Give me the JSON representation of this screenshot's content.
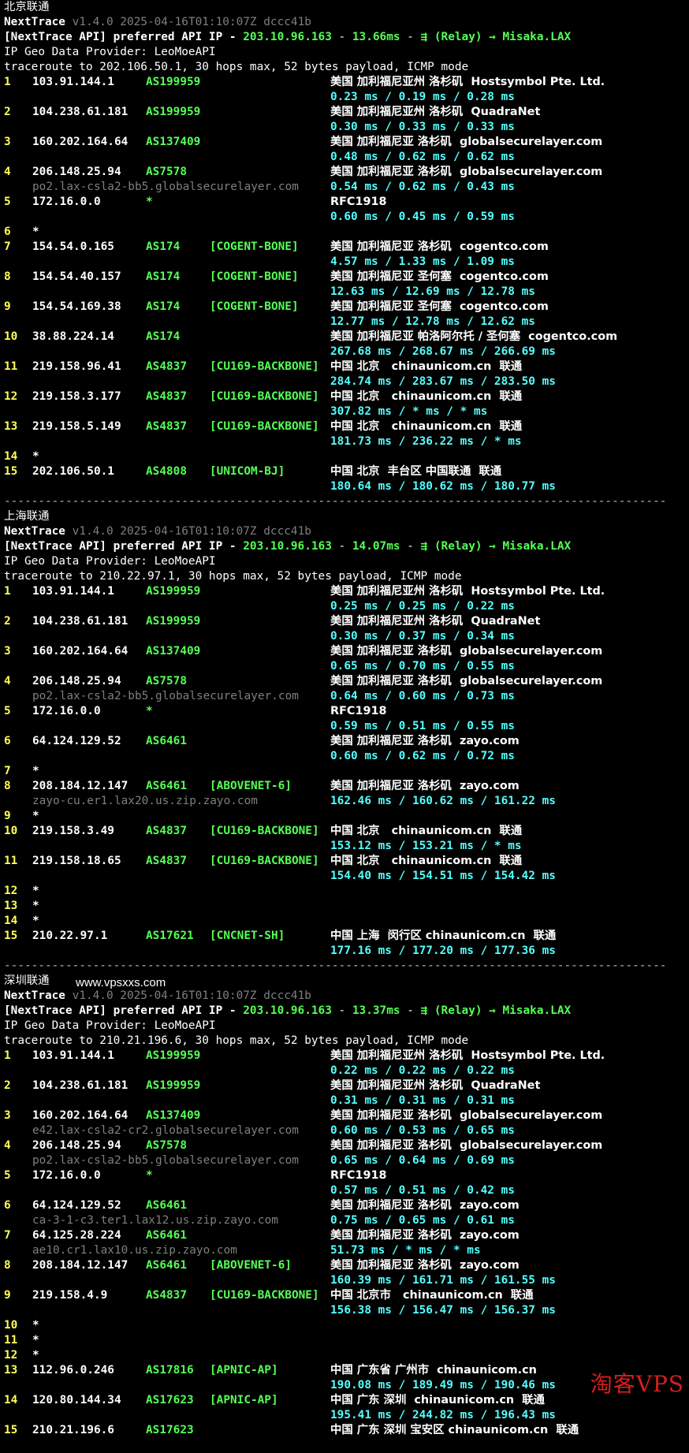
{
  "watermarks": {
    "site": "www.vpsxxs.com",
    "logo": "淘客VPS"
  },
  "separator": "-------------------------------------------------------------------------------------------------",
  "sections": [
    {
      "title": "北京联通",
      "header": {
        "app": "NextTrace",
        "version": "v1.4.0 2025-04-16T01:10:07Z dccc41b",
        "api_prefix": "[NextTrace API] preferred API IP - ",
        "api_ip": "203.10.96.163",
        "api_sep1": " - ",
        "api_latency": "13.66ms",
        "api_sep2": " - ",
        "relay": "⇶ (Relay) → Misaka.LAX",
        "geo_provider": "IP Geo Data Provider: LeoMoeAPI",
        "traceroute": "traceroute to 202.106.50.1, 30 hops max, 52 bytes payload, ICMP mode"
      },
      "hops": [
        {
          "hop": "1",
          "ip": "103.91.144.1",
          "asn": "AS199959",
          "tag": "",
          "geo": "美国 加利福尼亚州 洛杉矶  Hostsymbol Pte. Ltd.",
          "rdns": "",
          "rtt": "0.23 ms / 0.19 ms / 0.28 ms"
        },
        {
          "hop": "2",
          "ip": "104.238.61.181",
          "asn": "AS199959",
          "tag": "",
          "geo": "美国 加利福尼亚州 洛杉矶  QuadraNet",
          "rdns": "",
          "rtt": "0.30 ms / 0.33 ms / 0.33 ms"
        },
        {
          "hop": "3",
          "ip": "160.202.164.64",
          "asn": "AS137409",
          "tag": "",
          "geo": "美国 加利福尼亚 洛杉矶  globalsecurelayer.com",
          "rdns": "",
          "rtt": "0.48 ms / 0.62 ms / 0.62 ms"
        },
        {
          "hop": "4",
          "ip": "206.148.25.94",
          "asn": "AS7578",
          "tag": "",
          "geo": "美国 加利福尼亚 洛杉矶  globalsecurelayer.com",
          "rdns": "po2.lax-csla2-bb5.globalsecurelayer.com",
          "rtt": "0.54 ms / 0.62 ms / 0.43 ms"
        },
        {
          "hop": "5",
          "ip": "172.16.0.0",
          "asn": "*",
          "tag": "",
          "geo": "RFC1918",
          "rdns": "",
          "rtt": "0.60 ms / 0.45 ms / 0.59 ms"
        },
        {
          "hop": "6",
          "star": "*"
        },
        {
          "hop": "7",
          "ip": "154.54.0.165",
          "asn": "AS174",
          "tag": "[COGENT-BONE]",
          "geo": "美国 加利福尼亚 洛杉矶  cogentco.com",
          "rdns": "",
          "rtt": "4.57 ms / 1.33 ms / 1.09 ms"
        },
        {
          "hop": "8",
          "ip": "154.54.40.157",
          "asn": "AS174",
          "tag": "[COGENT-BONE]",
          "geo": "美国 加利福尼亚 圣何塞  cogentco.com",
          "rdns": "",
          "rtt": "12.63 ms / 12.69 ms / 12.78 ms"
        },
        {
          "hop": "9",
          "ip": "154.54.169.38",
          "asn": "AS174",
          "tag": "[COGENT-BONE]",
          "geo": "美国 加利福尼亚 圣何塞  cogentco.com",
          "rdns": "",
          "rtt": "12.77 ms / 12.78 ms / 12.62 ms"
        },
        {
          "hop": "10",
          "ip": "38.88.224.14",
          "asn": "AS174",
          "tag": "",
          "geo": "美国 加利福尼亚 帕洛阿尔托 / 圣何塞  cogentco.com",
          "rdns": "",
          "rtt": "267.68 ms / 268.67 ms / 266.69 ms"
        },
        {
          "hop": "11",
          "ip": "219.158.96.41",
          "asn": "AS4837",
          "tag": "[CU169-BACKBONE]",
          "geo": "中国 北京   chinaunicom.cn  联通",
          "rdns": "",
          "rtt": "284.74 ms / 283.67 ms / 283.50 ms"
        },
        {
          "hop": "12",
          "ip": "219.158.3.177",
          "asn": "AS4837",
          "tag": "[CU169-BACKBONE]",
          "geo": "中国 北京   chinaunicom.cn  联通",
          "rdns": "",
          "rtt": "307.82 ms / * ms / * ms"
        },
        {
          "hop": "13",
          "ip": "219.158.5.149",
          "asn": "AS4837",
          "tag": "[CU169-BACKBONE]",
          "geo": "中国 北京   chinaunicom.cn  联通",
          "rdns": "",
          "rtt": "181.73 ms / 236.22 ms / * ms"
        },
        {
          "hop": "14",
          "star": "*"
        },
        {
          "hop": "15",
          "ip": "202.106.50.1",
          "asn": "AS4808",
          "tag": "[UNICOM-BJ]",
          "geo": "中国 北京  丰台区 中国联通  联通",
          "rdns": "",
          "rtt": "180.64 ms / 180.62 ms / 180.77 ms"
        }
      ]
    },
    {
      "title": "上海联通",
      "header": {
        "app": "NextTrace",
        "version": "v1.4.0 2025-04-16T01:10:07Z dccc41b",
        "api_prefix": "[NextTrace API] preferred API IP - ",
        "api_ip": "203.10.96.163",
        "api_sep1": " - ",
        "api_latency": "14.07ms",
        "api_sep2": " - ",
        "relay": "⇶ (Relay) → Misaka.LAX",
        "geo_provider": "IP Geo Data Provider: LeoMoeAPI",
        "traceroute": "traceroute to 210.22.97.1, 30 hops max, 52 bytes payload, ICMP mode"
      },
      "hops": [
        {
          "hop": "1",
          "ip": "103.91.144.1",
          "asn": "AS199959",
          "tag": "",
          "geo": "美国 加利福尼亚州 洛杉矶  Hostsymbol Pte. Ltd.",
          "rdns": "",
          "rtt": "0.25 ms / 0.25 ms / 0.22 ms"
        },
        {
          "hop": "2",
          "ip": "104.238.61.181",
          "asn": "AS199959",
          "tag": "",
          "geo": "美国 加利福尼亚州 洛杉矶  QuadraNet",
          "rdns": "",
          "rtt": "0.30 ms / 0.37 ms / 0.34 ms"
        },
        {
          "hop": "3",
          "ip": "160.202.164.64",
          "asn": "AS137409",
          "tag": "",
          "geo": "美国 加利福尼亚 洛杉矶  globalsecurelayer.com",
          "rdns": "",
          "rtt": "0.65 ms / 0.70 ms / 0.55 ms"
        },
        {
          "hop": "4",
          "ip": "206.148.25.94",
          "asn": "AS7578",
          "tag": "",
          "geo": "美国 加利福尼亚 洛杉矶  globalsecurelayer.com",
          "rdns": "po2.lax-csla2-bb5.globalsecurelayer.com",
          "rtt": "0.64 ms / 0.60 ms / 0.73 ms"
        },
        {
          "hop": "5",
          "ip": "172.16.0.0",
          "asn": "*",
          "tag": "",
          "geo": "RFC1918",
          "rdns": "",
          "rtt": "0.59 ms / 0.51 ms / 0.55 ms"
        },
        {
          "hop": "6",
          "ip": "64.124.129.52",
          "asn": "AS6461",
          "tag": "",
          "geo": "美国 加利福尼亚 洛杉矶  zayo.com",
          "rdns": "",
          "rtt": "0.60 ms / 0.62 ms / 0.72 ms"
        },
        {
          "hop": "7",
          "star": "*"
        },
        {
          "hop": "8",
          "ip": "208.184.12.147",
          "asn": "AS6461",
          "tag": "[ABOVENET-6]",
          "geo": "美国 加利福尼亚 洛杉矶  zayo.com",
          "rdns": "zayo-cu.er1.lax20.us.zip.zayo.com",
          "rtt": "162.46 ms / 160.62 ms / 161.22 ms"
        },
        {
          "hop": "9",
          "star": "*"
        },
        {
          "hop": "10",
          "ip": "219.158.3.49",
          "asn": "AS4837",
          "tag": "[CU169-BACKBONE]",
          "geo": "中国 北京   chinaunicom.cn  联通",
          "rdns": "",
          "rtt": "153.12 ms / 153.21 ms / * ms"
        },
        {
          "hop": "11",
          "ip": "219.158.18.65",
          "asn": "AS4837",
          "tag": "[CU169-BACKBONE]",
          "geo": "中国 北京   chinaunicom.cn  联通",
          "rdns": "",
          "rtt": "154.40 ms / 154.51 ms / 154.42 ms"
        },
        {
          "hop": "12",
          "star": "*"
        },
        {
          "hop": "13",
          "star": "*"
        },
        {
          "hop": "14",
          "star": "*"
        },
        {
          "hop": "15",
          "ip": "210.22.97.1",
          "asn": "AS17621",
          "tag": "[CNCNET-SH]",
          "geo": "中国 上海  闵行区 chinaunicom.cn  联通",
          "rdns": "",
          "rtt": "177.16 ms / 177.20 ms / 177.36 ms"
        }
      ]
    },
    {
      "title": "深圳联通",
      "header": {
        "app": "NextTrace",
        "version": "v1.4.0 2025-04-16T01:10:07Z dccc41b",
        "api_prefix": "[NextTrace API] preferred API IP - ",
        "api_ip": "203.10.96.163",
        "api_sep1": " - ",
        "api_latency": "13.37ms",
        "api_sep2": " - ",
        "relay": "⇶ (Relay) → Misaka.LAX",
        "geo_provider": "IP Geo Data Provider: LeoMoeAPI",
        "traceroute": "traceroute to 210.21.196.6, 30 hops max, 52 bytes payload, ICMP mode"
      },
      "hops": [
        {
          "hop": "1",
          "ip": "103.91.144.1",
          "asn": "AS199959",
          "tag": "",
          "geo": "美国 加利福尼亚州 洛杉矶  Hostsymbol Pte. Ltd.",
          "rdns": "",
          "rtt": "0.22 ms / 0.22 ms / 0.22 ms"
        },
        {
          "hop": "2",
          "ip": "104.238.61.181",
          "asn": "AS199959",
          "tag": "",
          "geo": "美国 加利福尼亚州 洛杉矶  QuadraNet",
          "rdns": "",
          "rtt": "0.31 ms / 0.31 ms / 0.31 ms"
        },
        {
          "hop": "3",
          "ip": "160.202.164.64",
          "asn": "AS137409",
          "tag": "",
          "geo": "美国 加利福尼亚 洛杉矶  globalsecurelayer.com",
          "rdns": "e42.lax-csla2-cr2.globalsecurelayer.com",
          "rtt": "0.60 ms / 0.53 ms / 0.65 ms"
        },
        {
          "hop": "4",
          "ip": "206.148.25.94",
          "asn": "AS7578",
          "tag": "",
          "geo": "美国 加利福尼亚 洛杉矶  globalsecurelayer.com",
          "rdns": "po2.lax-csla2-bb5.globalsecurelayer.com",
          "rtt": "0.65 ms / 0.64 ms / 0.69 ms"
        },
        {
          "hop": "5",
          "ip": "172.16.0.0",
          "asn": "*",
          "tag": "",
          "geo": "RFC1918",
          "rdns": "",
          "rtt": "0.57 ms / 0.51 ms / 0.42 ms"
        },
        {
          "hop": "6",
          "ip": "64.124.129.52",
          "asn": "AS6461",
          "tag": "",
          "geo": "美国 加利福尼亚 洛杉矶  zayo.com",
          "rdns": "ca-3-1-c3.ter1.lax12.us.zip.zayo.com",
          "rtt": "0.75 ms / 0.65 ms / 0.61 ms"
        },
        {
          "hop": "7",
          "ip": "64.125.28.224",
          "asn": "AS6461",
          "tag": "",
          "geo": "美国 加利福尼亚 洛杉矶  zayo.com",
          "rdns": "ae10.cr1.lax10.us.zip.zayo.com",
          "rtt": "51.73 ms / * ms / * ms"
        },
        {
          "hop": "8",
          "ip": "208.184.12.147",
          "asn": "AS6461",
          "tag": "[ABOVENET-6]",
          "geo": "美国 加利福尼亚 洛杉矶  zayo.com",
          "rdns": "",
          "rtt": "160.39 ms / 161.71 ms / 161.55 ms"
        },
        {
          "hop": "9",
          "ip": "219.158.4.9",
          "asn": "AS4837",
          "tag": "[CU169-BACKBONE]",
          "geo": "中国 北京市   chinaunicom.cn  联通",
          "rdns": "",
          "rtt": "156.38 ms / 156.47 ms / 156.37 ms"
        },
        {
          "hop": "10",
          "star": "*"
        },
        {
          "hop": "11",
          "star": "*"
        },
        {
          "hop": "12",
          "star": "*"
        },
        {
          "hop": "13",
          "ip": "112.96.0.246",
          "asn": "AS17816",
          "tag": "[APNIC-AP]",
          "geo": "中国 广东省 广州市  chinaunicom.cn",
          "rdns": "",
          "rtt": "190.08 ms / 189.49 ms / 190.46 ms"
        },
        {
          "hop": "14",
          "ip": "120.80.144.34",
          "asn": "AS17623",
          "tag": "[APNIC-AP]",
          "geo": "中国 广东 深圳  chinaunicom.cn  联通",
          "rdns": "",
          "rtt": "195.41 ms / 244.82 ms / 196.43 ms"
        },
        {
          "hop": "15",
          "ip": "210.21.196.6",
          "asn": "AS17623",
          "tag": "",
          "geo": "中国 广东 深圳 宝安区 chinaunicom.cn  联通",
          "rdns": "",
          "rtt": ""
        }
      ]
    }
  ]
}
